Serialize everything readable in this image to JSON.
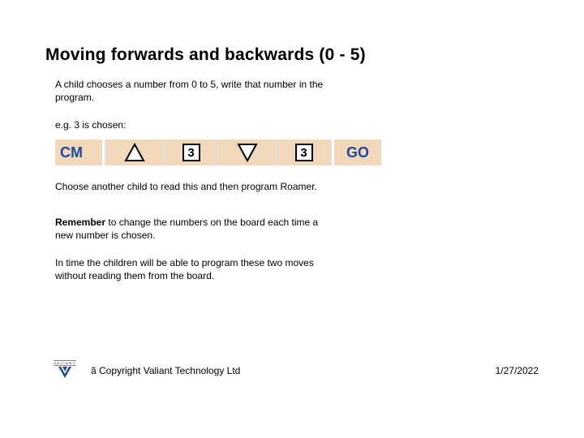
{
  "title": "Moving forwards and backwards (0 - 5)",
  "paragraphs": {
    "p1": "A child chooses a number from 0 to 5, write that number in the program.",
    "eg": "e.g. 3 is chosen:",
    "p2": "Choose another child to read this and then program Roamer.",
    "remember_bold": "Remember",
    "remember_rest": " to change the numbers on the board each time a new number is chosen.",
    "p3": "In time the children will be able to program these two moves without reading them from the board."
  },
  "cmdbar": {
    "cm": "CM",
    "num1": "3",
    "num2": "3",
    "go": "GO",
    "icons": {
      "forward": "arrow-up-icon",
      "backward": "arrow-down-icon"
    }
  },
  "footer": {
    "logo_text": "VALIANT",
    "copyright": "ã Copyright Valiant Technology Ltd",
    "date": "1/27/2022"
  }
}
